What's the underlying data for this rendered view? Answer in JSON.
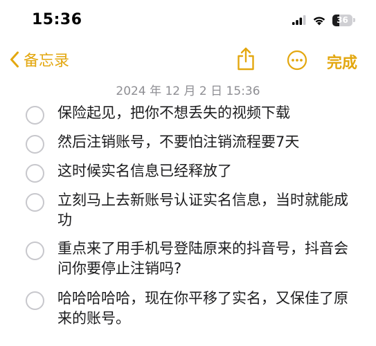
{
  "status_bar": {
    "time": "15:36",
    "battery_level": "36"
  },
  "nav": {
    "back_label": "备忘录",
    "done_label": "完成",
    "icons": [
      "chevron-left-icon",
      "share-icon",
      "more-icon"
    ]
  },
  "note": {
    "date": "2024 年 12 月 2 日 15:36",
    "items": [
      {
        "text": "保险起见，把你不想丢失的视频下载",
        "checked": false
      },
      {
        "text": "然后注销账号，不要怕注销流程要7天",
        "checked": false
      },
      {
        "text": "这时候实名信息已经释放了",
        "checked": false
      },
      {
        "text": "立刻马上去新账号认证实名信息，当时就能成功",
        "checked": false
      },
      {
        "text": "重点来了用手机号登陆原来的抖音号，抖音会问你要停止注销吗?",
        "checked": false
      },
      {
        "text": "哈哈哈哈哈，现在你平移了实名，又保佳了原来的账号。",
        "checked": false
      }
    ]
  },
  "colors": {
    "accent": "#e3a70f",
    "date_text": "#8e8e93",
    "circle_border": "#c7c7cc"
  }
}
